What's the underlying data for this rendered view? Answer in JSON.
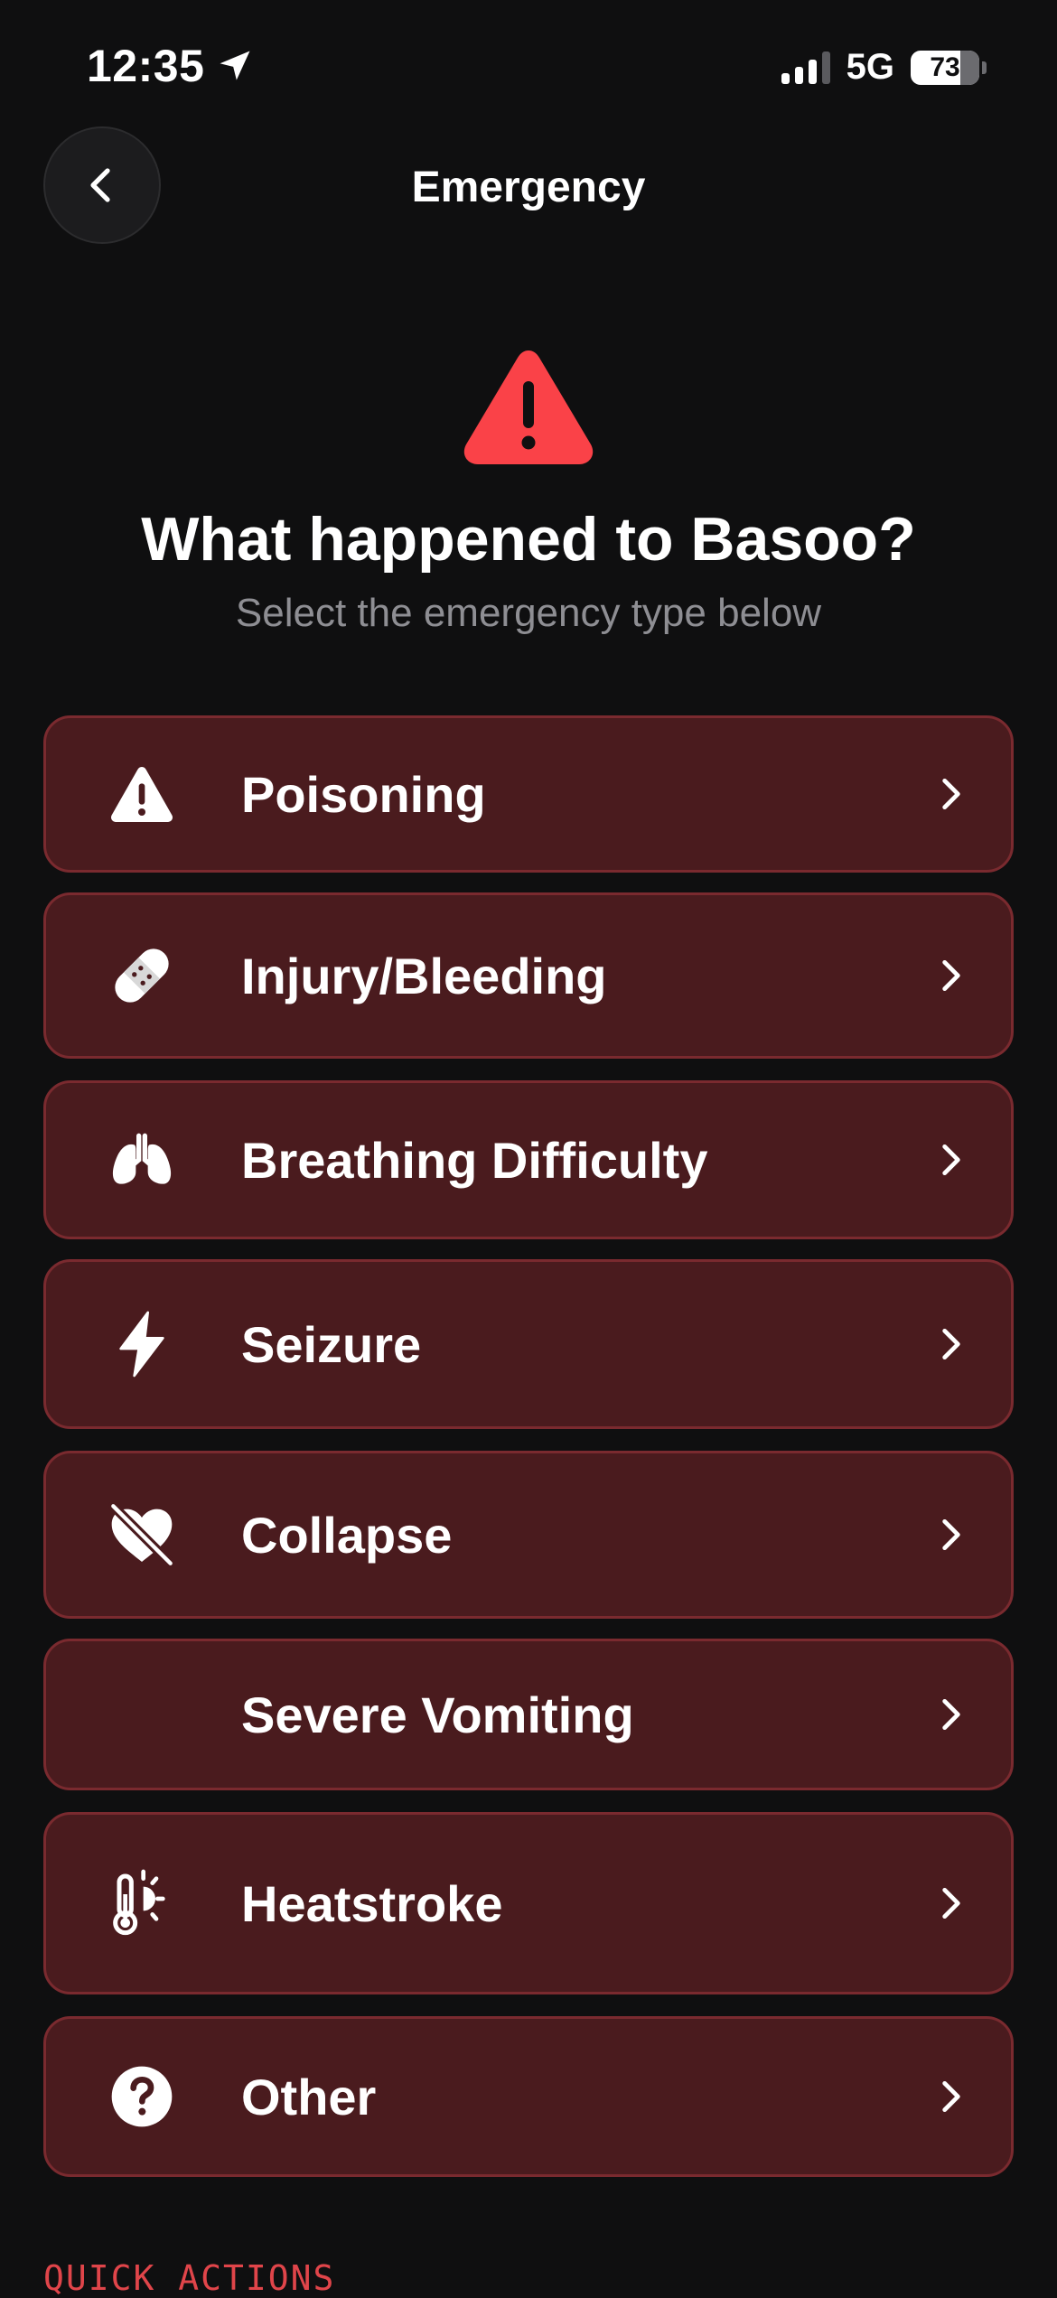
{
  "status_bar": {
    "time": "12:35",
    "network": "5G",
    "battery": "73",
    "battery_level": 0.73,
    "signal_bars_active": 3,
    "signal_bars_total": 4
  },
  "nav": {
    "title": "Emergency",
    "back_icon": "chevron-left-icon"
  },
  "hero": {
    "icon": "warning-triangle-icon",
    "title": "What happened to Basoo?",
    "subtitle": "Select the emergency type below"
  },
  "colors": {
    "background": "#0f0f10",
    "card_background": "#4a1b1e",
    "card_border": "#7a2a2f",
    "alert_red": "#fa4248",
    "secondary_text": "#8e8e93"
  },
  "options": [
    {
      "label": "Poisoning",
      "icon": "warning-triangle-icon"
    },
    {
      "label": "Injury/Bleeding",
      "icon": "bandage-icon"
    },
    {
      "label": "Breathing Difficulty",
      "icon": "lungs-icon"
    },
    {
      "label": "Seizure",
      "icon": "lightning-bolt-icon"
    },
    {
      "label": "Collapse",
      "icon": "heart-slash-icon"
    },
    {
      "label": "Severe Vomiting",
      "icon": ""
    },
    {
      "label": "Heatstroke",
      "icon": "thermometer-sun-icon"
    },
    {
      "label": "Other",
      "icon": "question-circle-icon"
    }
  ],
  "quick_actions": {
    "label": "QUICK ACTIONS"
  }
}
